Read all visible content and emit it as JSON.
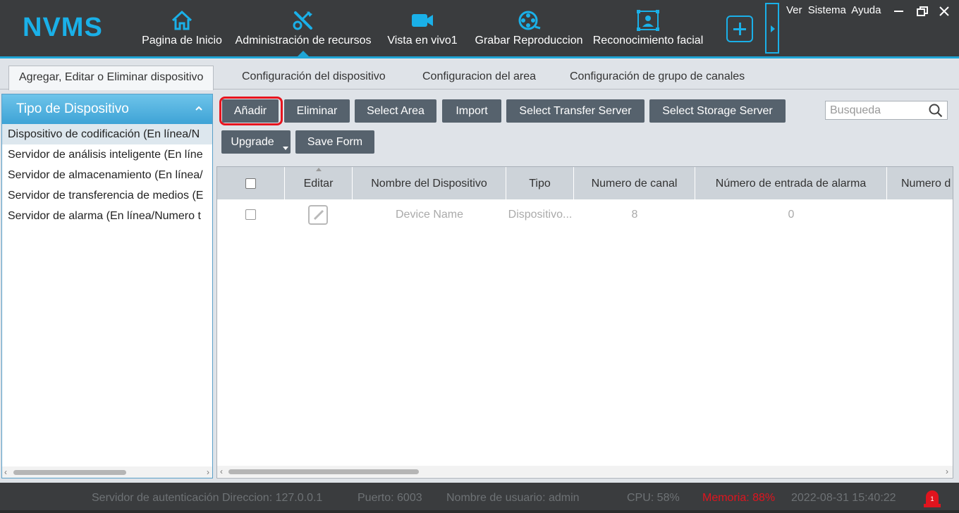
{
  "app": {
    "logo": "NVMS",
    "top_links": [
      "Ver",
      "Sistema",
      "Ayuda"
    ]
  },
  "nav": [
    {
      "label": "Pagina de Inicio",
      "icon": "home-icon"
    },
    {
      "label": "Administración de recursos",
      "icon": "tools-icon",
      "active": true
    },
    {
      "label": "Vista en vivo1",
      "icon": "camera-icon"
    },
    {
      "label": "Grabar Reproduccion",
      "icon": "film-reel-icon"
    },
    {
      "label": "Reconocimiento facial",
      "icon": "face-scan-icon"
    }
  ],
  "tabs": [
    {
      "label": "Agregar, Editar o Eliminar dispositivo",
      "active": true
    },
    {
      "label": "Configuración del dispositivo"
    },
    {
      "label": "Configuracion del area"
    },
    {
      "label": "Configuración de grupo de canales"
    }
  ],
  "left_panel": {
    "title": "Tipo de Dispositivo",
    "items": [
      "Dispositivo de codificación (En línea/N",
      "Servidor de análisis inteligente (En líne",
      "Servidor de almacenamiento (En línea/",
      "Servidor de transferencia de medios (E",
      "Servidor de alarma (En línea/Numero t"
    ]
  },
  "toolbar": {
    "add": "Añadir",
    "delete": "Eliminar",
    "select_area": "Select Area",
    "import": "Import",
    "select_transfer": "Select Transfer Server",
    "select_storage": "Select Storage Server",
    "upgrade": "Upgrade",
    "save_form": "Save Form",
    "search_placeholder": "Busqueda"
  },
  "table": {
    "columns": [
      "Editar",
      "Nombre del Dispositivo",
      "Tipo",
      "Numero de canal",
      "Número de entrada de alarma",
      "Numero d"
    ],
    "rows": [
      {
        "name": "Device Name",
        "type": "Dispositivo...",
        "channels": "8",
        "alarm_inputs": "0"
      }
    ]
  },
  "status": {
    "auth": "Servidor de autenticación Direccion: 127.0.0.1",
    "port": "Puerto: 6003",
    "user": "Nombre de usuario: admin",
    "cpu": "CPU: 58%",
    "memory": "Memoria: 88%",
    "datetime": "2022-08-31 15:40:22",
    "alarm_count": "1"
  },
  "colors": {
    "accent": "#1ab0e8",
    "header_bg": "#3a3c3e",
    "button_bg": "#56626d",
    "highlight": "#e8141e"
  }
}
